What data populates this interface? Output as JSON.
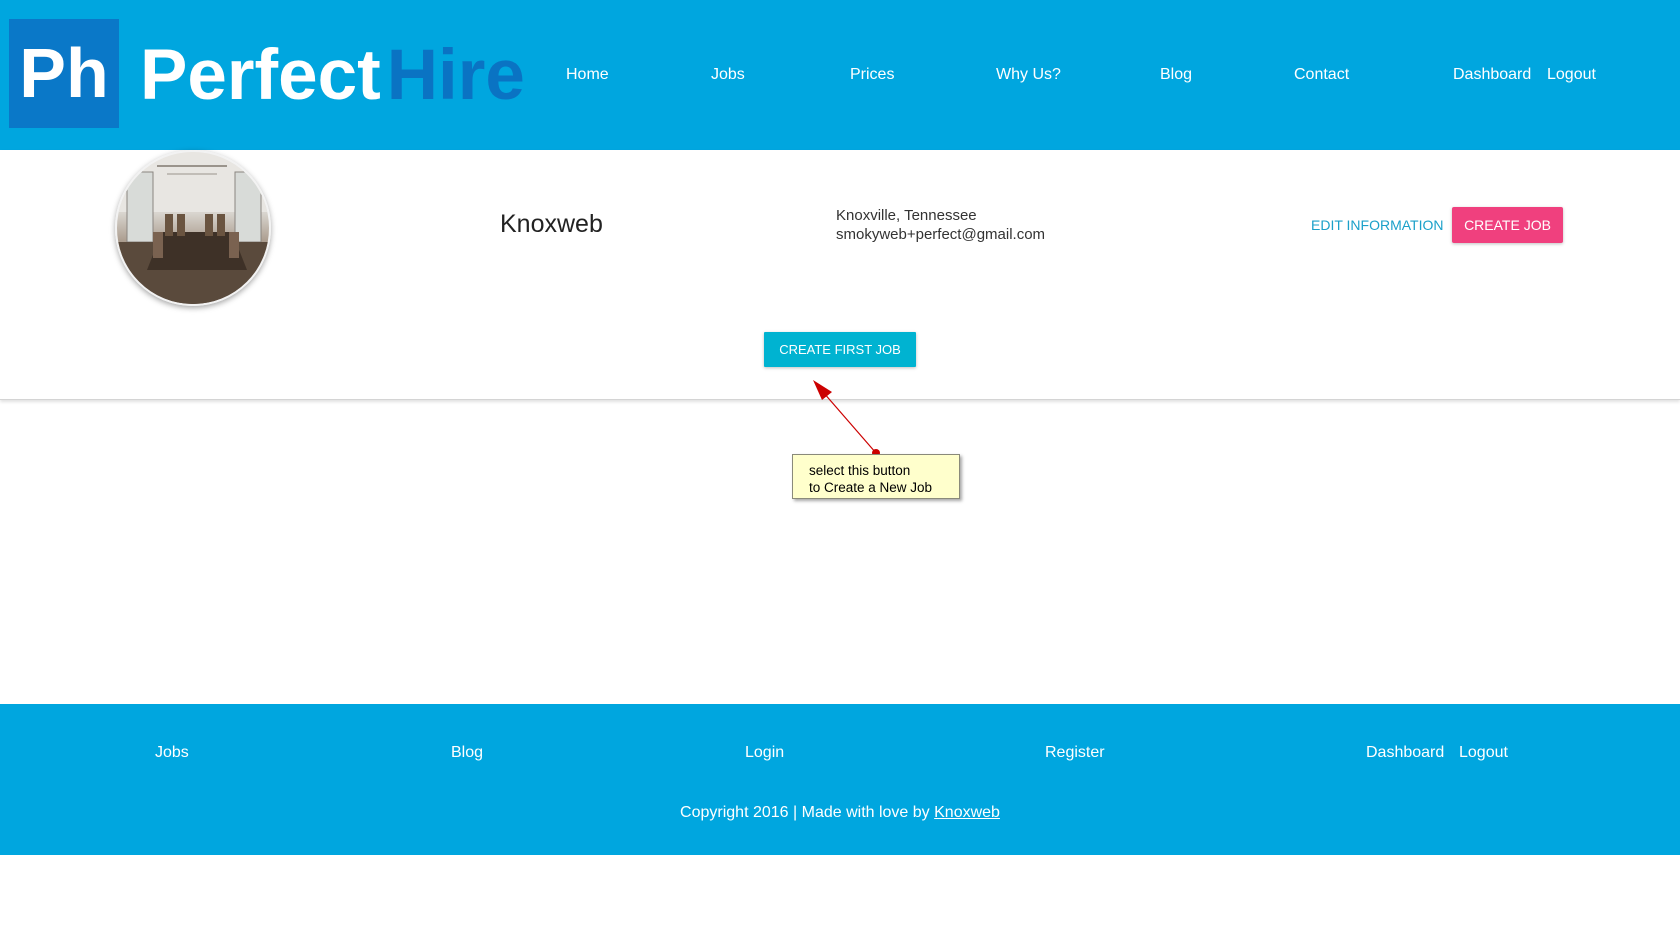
{
  "brand": {
    "badge": "Ph",
    "name_part1": "Perfect",
    "name_part2": "Hire"
  },
  "nav": {
    "items": [
      "Home",
      "Jobs",
      "Prices",
      "Why Us?",
      "Blog",
      "Contact"
    ],
    "dashboard": "Dashboard",
    "logout": "Logout"
  },
  "profile": {
    "name": "Knoxweb",
    "location": "Knoxville, Tennessee",
    "email": "smokyweb+perfect@gmail.com",
    "edit_label": "EDIT INFORMATION",
    "create_job_label": "CREATE JOB",
    "create_first_job_label": "CREATE FIRST JOB"
  },
  "annotation": {
    "line1": "select this button",
    "line2": "to Create a New Job"
  },
  "footer": {
    "links": [
      "Jobs",
      "Blog",
      "Login",
      "Register"
    ],
    "dashboard": "Dashboard",
    "logout": "Logout",
    "copyright_prefix": "Copyright 2016 | Made with love by ",
    "copyright_link": "Knoxweb"
  },
  "colors": {
    "header_bg": "#00a6df",
    "logo_dark": "#0a78c8",
    "create_job_btn": "#f0407e",
    "create_first_btn": "#00b3d1",
    "callout_bg": "#ffffcc",
    "arrow": "#cc0000"
  }
}
